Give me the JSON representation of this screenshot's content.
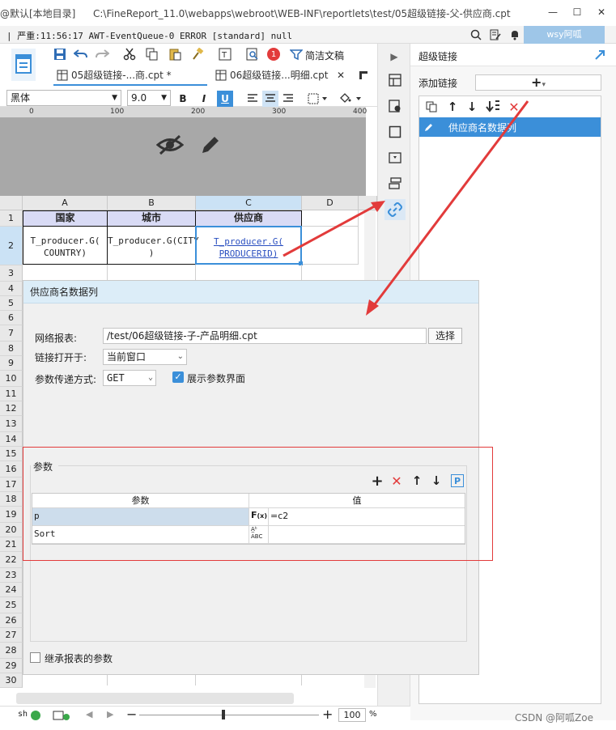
{
  "window": {
    "title_prefix": "@默认[本地目录]",
    "path": "C:\\FineReport_11.0\\webapps\\webroot\\WEB-INF\\reportlets\\test/05超级链接-父-供应商.cpt",
    "minimize": "—",
    "maximize": "☐",
    "close": "✕"
  },
  "log": {
    "text": "| 严重:11:56:17 AWT-EventQueue-0 ERROR [standard] null",
    "user": "wsy阿呱"
  },
  "toolbar": {
    "badge": "1",
    "simplify_label": "简洁文稿",
    "tabs": [
      {
        "label": "05超级链接-...商.cpt *"
      },
      {
        "label": "06超级链接...明细.cpt"
      }
    ],
    "font_name": "黑体",
    "font_size": "9.0",
    "bold": "B",
    "italic": "I",
    "underline": "U"
  },
  "ruler": {
    "ticks": [
      "0",
      "100",
      "200",
      "300",
      "400"
    ]
  },
  "sheet": {
    "columns": [
      "A",
      "B",
      "C",
      "D"
    ],
    "rows": [
      "1",
      "2",
      "3",
      "4",
      "5",
      "6",
      "7",
      "8",
      "9",
      "10",
      "11",
      "12",
      "13",
      "14",
      "15",
      "16",
      "17",
      "18",
      "19",
      "20",
      "21",
      "22",
      "23",
      "24",
      "25",
      "26",
      "27",
      "28",
      "29",
      "30"
    ],
    "headers": [
      "国家",
      "城市",
      "供应商"
    ],
    "formulas": {
      "a2_l1": "T_producer.G(",
      "a2_l2": "COUNTRY)",
      "b2_l1": "T_producer.G(CITY",
      "b2_l2": ")",
      "c2_l1": "T_producer.G(",
      "c2_l2": "PRODUCERID)"
    }
  },
  "right_panel": {
    "title": "超级链接",
    "add_label": "添加链接",
    "add_button": "+",
    "link_item": "供应商名数据列"
  },
  "dialog": {
    "title": "供应商名数据列",
    "net_report_label": "网络报表:",
    "net_report_value": "/test/06超级链接-子-产品明细.cpt",
    "select_btn": "选择",
    "open_in_label": "链接打开于:",
    "open_in_value": "当前窗口",
    "param_method_label": "参数传递方式:",
    "param_method_value": "GET",
    "show_param_label": "展示参数界面",
    "show_param_checked": true,
    "params_group": "参数",
    "table_headers": [
      "参数",
      "值"
    ],
    "params": [
      {
        "name": "p",
        "value": "=c2"
      },
      {
        "name": "Sort",
        "value": ""
      }
    ],
    "inherit_label": "继承报表的参数"
  },
  "status": {
    "sheet_label": "sh",
    "zoom": "100",
    "percent": "%"
  },
  "watermark": "CSDN @阿呱Zoe",
  "colors": {
    "accent": "#3b8fd9",
    "annotation": "#e23b3b",
    "selected": "#3b8fd9"
  }
}
